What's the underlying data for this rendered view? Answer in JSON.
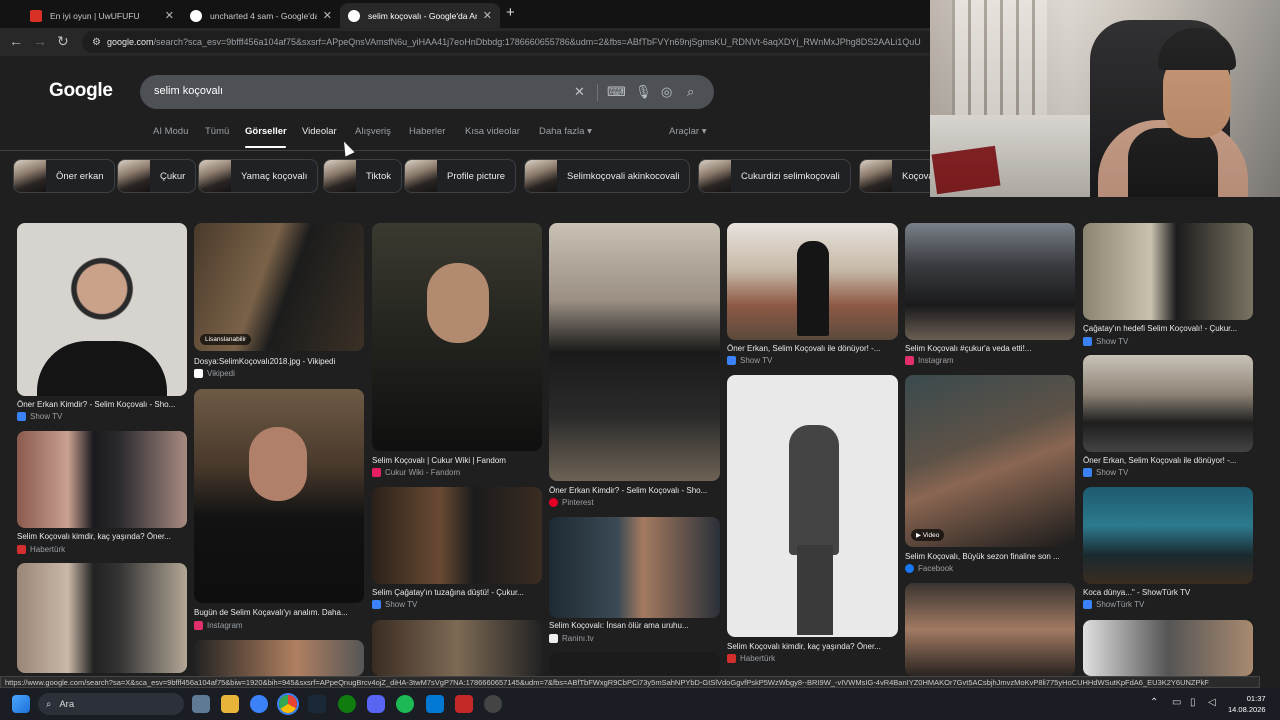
{
  "browser": {
    "tabs": [
      {
        "title": "En iyi oyun | UwUFUFU",
        "favicon_color": "#d93025",
        "active": false
      },
      {
        "title": "uncharted 4 sam - Google'da Ar",
        "favicon_color": "#4285f4",
        "active": false
      },
      {
        "title": "selim koçovalı - Google'da Ara",
        "favicon_color": "#4285f4",
        "active": true
      }
    ],
    "new_tab": "+",
    "url_host": "google.com",
    "url_rest": "/search?sca_esv=9bfff456a104af75&sxsrf=APpeQnsVAmsfN6u_yiHAA41j7eoHnDbbdg:1786660655786&udm=2&fbs=ABfTbFVYn69njSgmsKU_RDNVt-6aqXDYj_RWnMxJPhg8DS2AALi1QuU"
  },
  "google": {
    "logo": "Google",
    "query": "selim koçovalı",
    "nav_tabs": [
      "AI Modu",
      "Tümü",
      "Görseller",
      "Videolar",
      "Alışveriş",
      "Haberler",
      "Kısa videolar",
      "Daha fazla",
      "Araçlar"
    ],
    "selected_tab": "Görseller",
    "more_arrow": "▾"
  },
  "chips": [
    "Öner erkan",
    "Çukur",
    "Yamaç koçovalı",
    "Tiktok",
    "Profile picture",
    "Selimkoçovali akinkocovali",
    "Cukurdizi selimkoçovali",
    "Koçova"
  ],
  "results": {
    "col1": [
      {
        "caption": "Öner Erkan Kimdir? - Selim Koçovalı - Sho...",
        "source": "Show TV",
        "src_color": "#3b82f6"
      },
      {
        "caption": "Selim Koçovalı kimdir, kaç yaşında? Öner...",
        "source": "Habertürk",
        "src_color": "#d32f2f"
      }
    ],
    "col2": [
      {
        "caption": "Dosya:SelimKoçovalı2018.jpg - Vikipedi",
        "source": "Vikipedi",
        "src_color": "#ffffff",
        "badge": "Lisanslanabilir"
      },
      {
        "caption": "Bugün de Selim Koçavalı'yı analım. Daha...",
        "source": "Instagram",
        "src_color": "#e1306c"
      }
    ],
    "col3": [
      {
        "caption": "Selim Koçovalı | Cukur Wiki | Fandom",
        "source": "Cukur Wiki - Fandom",
        "src_color": "#e91e63"
      },
      {
        "caption": "Selim Çağatay'ın tuzağına düştü! - Çukur...",
        "source": "Show TV",
        "src_color": "#3b82f6"
      }
    ],
    "col4": [
      {
        "caption": "Öner Erkan Kimdir? - Selim Koçovalı - Sho...",
        "source": "Pinterest",
        "src_color": "#e60023"
      },
      {
        "caption": "Selim Koçovalı: İnsan ölür ama uruhu...",
        "source": "Raninı.tv",
        "src_color": "#eeeeee"
      }
    ],
    "col5": [
      {
        "caption": "Öner Erkan, Selim Koçovalı ile dönüyor! -...",
        "source": "Show TV",
        "src_color": "#3b82f6"
      },
      {
        "caption": "Selim Koçovalı kimdir, kaç yaşında? Öner...",
        "source": "Habertürk",
        "src_color": "#d32f2f"
      }
    ],
    "col6": [
      {
        "caption": "Selim Koçovalı #çukur'a veda etti!...",
        "source": "Instagram",
        "src_color": "#e1306c"
      },
      {
        "caption": "Selim Koçovalı, Büyük sezon finaline son ...",
        "source": "Facebook",
        "src_color": "#1877f2",
        "badge": "▶ Video"
      }
    ],
    "col7": [
      {
        "caption": "Çağatay'ın hedefi Selim Koçovalı! - Çukur...",
        "source": "Show TV",
        "src_color": "#3b82f6"
      },
      {
        "caption": "Öner Erkan, Selim Koçovalı ile dönüyor! -...",
        "source": "Show TV",
        "src_color": "#3b82f6"
      },
      {
        "caption": "Koca dünya...\" - ShowTürk TV",
        "source": "ShowTürk TV",
        "src_color": "#3b82f6"
      }
    ]
  },
  "status_url": "https://www.google.com/search?sa=X&sca_esv=9bfff456a104af75&biw=1920&bih=945&sxsrf=APpeQnugBrcv4ojZ_diHA-3twM7sVgP7NA:1786660657145&udm=7&fbs=ABfTbFWxgR9CbPCi73y5mSahNPYbD-GtSlVdoGgvfPskP5WzWbgy8--BRI9W_-vIVWMsIG-4vR4BanIYZ0HMAKOr7Gvt5ACsbjhJmvzMoKvP8li775yHoCUHHdWSutKpFdA6_EU3K2Y6UNZPkF",
  "taskbar": {
    "search_label": "Ara",
    "time": "01:37",
    "date": "14.08.2026"
  }
}
